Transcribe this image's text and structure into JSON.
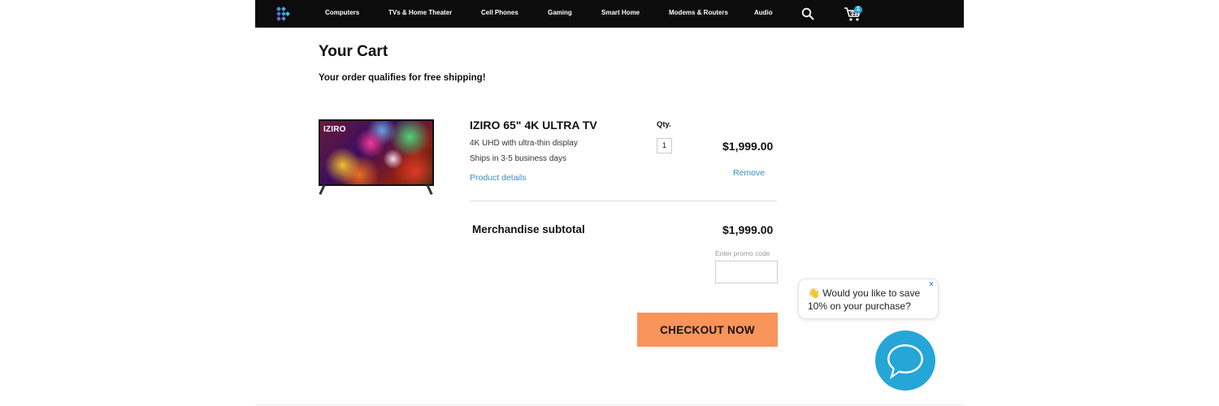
{
  "nav": {
    "items": [
      "Computers",
      "TVs & Home Theater",
      "Cell Phones",
      "Gaming",
      "Smart Home",
      "Modems & Routers",
      "Audio"
    ],
    "cart_count": "1",
    "logo_icon": "diamond-arrow-logo-icon",
    "search_icon": "search-icon",
    "cart_icon": "shopping-cart-icon"
  },
  "cart": {
    "title": "Your Cart",
    "subtitle": "Your order qualifies for free shipping!",
    "qty_label": "Qty.",
    "item": {
      "image_brand": "IZIRO",
      "name": "IZIRO 65\" 4K ULTRA TV",
      "description": "4K UHD with ultra-thin display",
      "shipping": "Ships in 3-5 business days",
      "details_link": "Product details",
      "quantity": "1",
      "price": "$1,999.00",
      "remove_label": "Remove"
    },
    "subtotal_label": "Merchandise subtotal",
    "subtotal_value": "$1,999.00",
    "promo_label": "Enter promo code",
    "promo_value": "",
    "checkout_label": "CHECKOUT NOW"
  },
  "chat": {
    "emoji": "👋",
    "message": "Would you like to save 10% on your purchase?",
    "close_glyph": "×"
  },
  "colors": {
    "nav_bg": "#0c0c0c",
    "accent_blue": "#2aa8d6",
    "link_blue": "#3a8bc2",
    "checkout_orange": "#f9945a"
  }
}
